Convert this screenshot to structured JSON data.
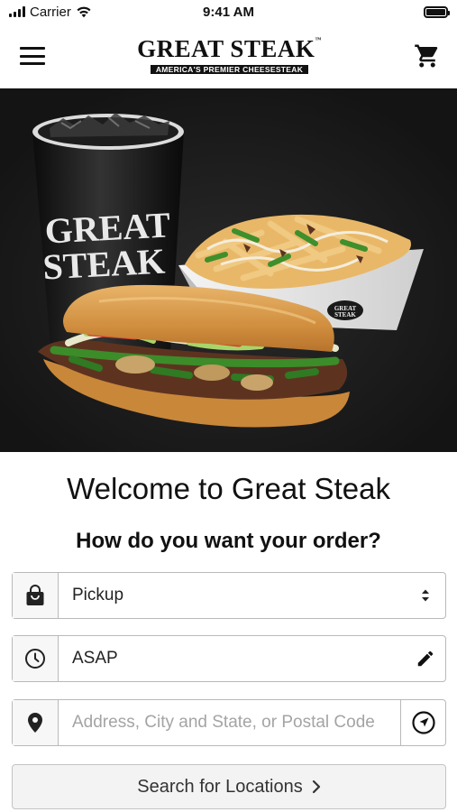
{
  "status_bar": {
    "carrier": "Carrier",
    "time": "9:41 AM",
    "battery_level": 1.0,
    "icons": [
      "signal-icon",
      "wifi-icon",
      "battery-icon"
    ]
  },
  "header": {
    "logo_main": "GREAT STEAK",
    "logo_tm": "™",
    "logo_tagline": "AMERICA'S PREMIER CHEESESTEAK",
    "icons": [
      "menu-icon",
      "cart-icon"
    ]
  },
  "hero": {
    "cup_text_line1": "GREAT",
    "cup_text_line2": "STEAK",
    "tray_text_line1": "GREAT",
    "tray_text_line2": "STEAK"
  },
  "main": {
    "welcome_title": "Welcome to Great Steak",
    "order_question": "How do you want your order?",
    "order_type": {
      "value": "Pickup",
      "icon": "shopping-bag-icon",
      "action_icon": "sort-arrows-icon"
    },
    "order_time": {
      "value": "ASAP",
      "icon": "clock-icon",
      "action_icon": "pencil-icon"
    },
    "location": {
      "placeholder": "Address, City and State, or Postal Code",
      "icon": "location-pin-icon",
      "action_icon": "locate-me-icon"
    },
    "search_button": {
      "label": "Search for Locations",
      "icon": "chevron-right-icon"
    }
  },
  "colors": {
    "hero_background": "#161616",
    "border": "#b9b9b9",
    "icon_cell_background": "#f7f7f7",
    "button_background": "#f3f3f3",
    "text_primary": "#111111",
    "placeholder": "#a4a4a4"
  }
}
